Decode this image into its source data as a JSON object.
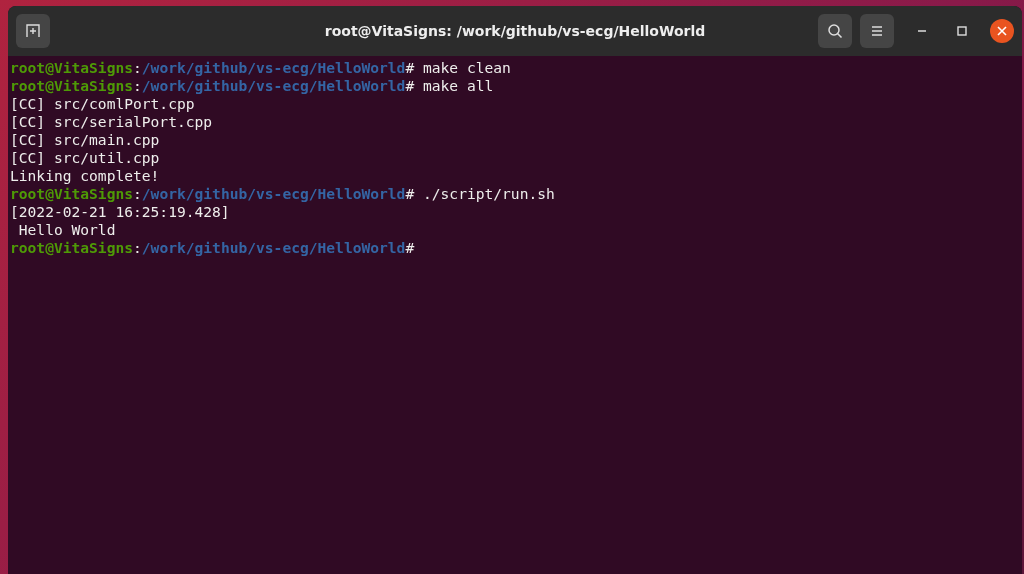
{
  "window": {
    "title": "root@VitaSigns: /work/github/vs-ecg/HelloWorld"
  },
  "terminal": {
    "lines": [
      {
        "kind": "prompt",
        "user": "root@VitaSigns",
        "separator": ":",
        "path": "/work/github/vs-ecg/HelloWorld",
        "symbol": "#",
        "command": " make clean"
      },
      {
        "kind": "prompt",
        "user": "root@VitaSigns",
        "separator": ":",
        "path": "/work/github/vs-ecg/HelloWorld",
        "symbol": "#",
        "command": " make all"
      },
      {
        "kind": "output",
        "text": "[CC] src/comlPort.cpp"
      },
      {
        "kind": "output",
        "text": "[CC] src/serialPort.cpp"
      },
      {
        "kind": "output",
        "text": "[CC] src/main.cpp"
      },
      {
        "kind": "output",
        "text": "[CC] src/util.cpp"
      },
      {
        "kind": "output",
        "text": "Linking complete!"
      },
      {
        "kind": "prompt",
        "user": "root@VitaSigns",
        "separator": ":",
        "path": "/work/github/vs-ecg/HelloWorld",
        "symbol": "#",
        "command": " ./script/run.sh"
      },
      {
        "kind": "output",
        "text": "[2022-02-21 16:25:19.428]"
      },
      {
        "kind": "output",
        "text": " Hello World"
      },
      {
        "kind": "prompt",
        "user": "root@VitaSigns",
        "separator": ":",
        "path": "/work/github/vs-ecg/HelloWorld",
        "symbol": "#"
      }
    ]
  }
}
